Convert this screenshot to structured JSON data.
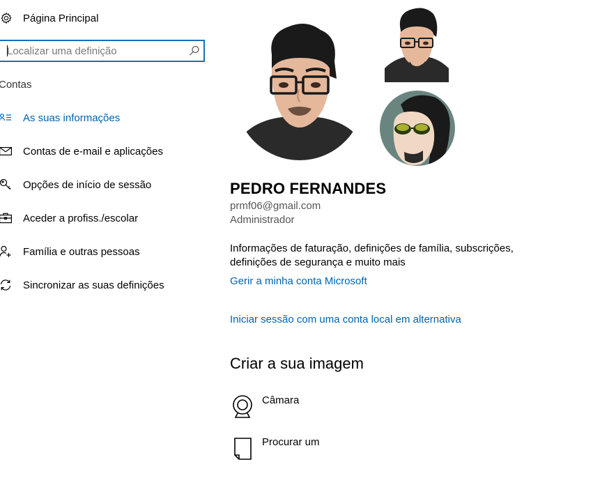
{
  "sidebar": {
    "home": {
      "label": "Página Principal",
      "icon": "gear-icon"
    },
    "search": {
      "placeholder": "Localizar uma definição",
      "value": "",
      "icon": "search-icon"
    },
    "section_title": "Contas",
    "items": [
      {
        "label": "As suas informações",
        "icon": "person-card-icon",
        "active": true
      },
      {
        "label": "Contas de e-mail e aplicações",
        "icon": "mail-icon",
        "active": false
      },
      {
        "label": "Opções de início de sessão",
        "icon": "key-icon",
        "active": false
      },
      {
        "label": "Aceder a profiss./escolar",
        "icon": "briefcase-icon",
        "active": false
      },
      {
        "label": "Família e outras pessoas",
        "icon": "person-add-icon",
        "active": false
      },
      {
        "label": "Sincronizar as suas definições",
        "icon": "sync-icon",
        "active": false
      }
    ]
  },
  "profile": {
    "name": "PEDRO FERNANDES",
    "email": "prmf06@gmail.com",
    "role": "Administrador",
    "description": "Informações de faturação, definições de família, subscrições, definições de segurança e muito mais",
    "manage_link": "Gerir a minha conta Microsoft",
    "local_link": "Iniciar sessão com uma conta local em alternativa"
  },
  "create_image": {
    "title": "Criar a sua imagem",
    "options": [
      {
        "label": "Câmara",
        "icon": "camera-icon"
      },
      {
        "label": "Procurar um",
        "icon": "document-icon"
      }
    ]
  },
  "colors": {
    "accent": "#0063b1",
    "search_border": "#1b6fb5"
  }
}
